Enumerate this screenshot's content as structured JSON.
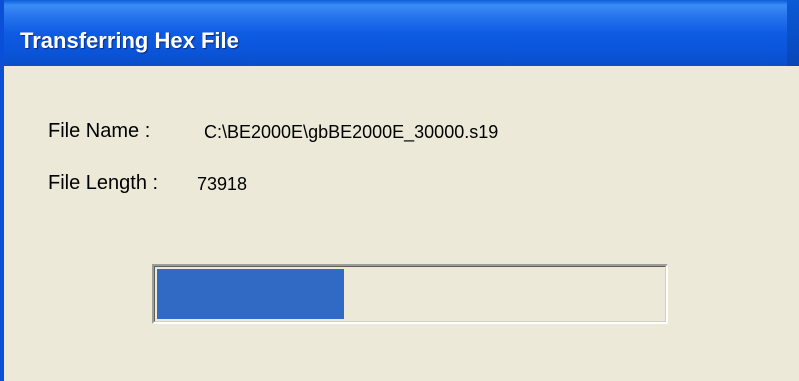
{
  "window": {
    "title": "Transferring Hex File"
  },
  "file_info": {
    "name_label": "File Name :",
    "name_value": "C:\\BE2000E\\gbBE2000E_30000.s19",
    "length_label": "File Length :",
    "length_value": "73918"
  },
  "progress": {
    "fraction": 0.37
  },
  "colors": {
    "titlebar": "#0a54d8",
    "window_bg": "#ece9d8",
    "progress_fill": "#316ac5",
    "title_text": "#ffffff"
  }
}
